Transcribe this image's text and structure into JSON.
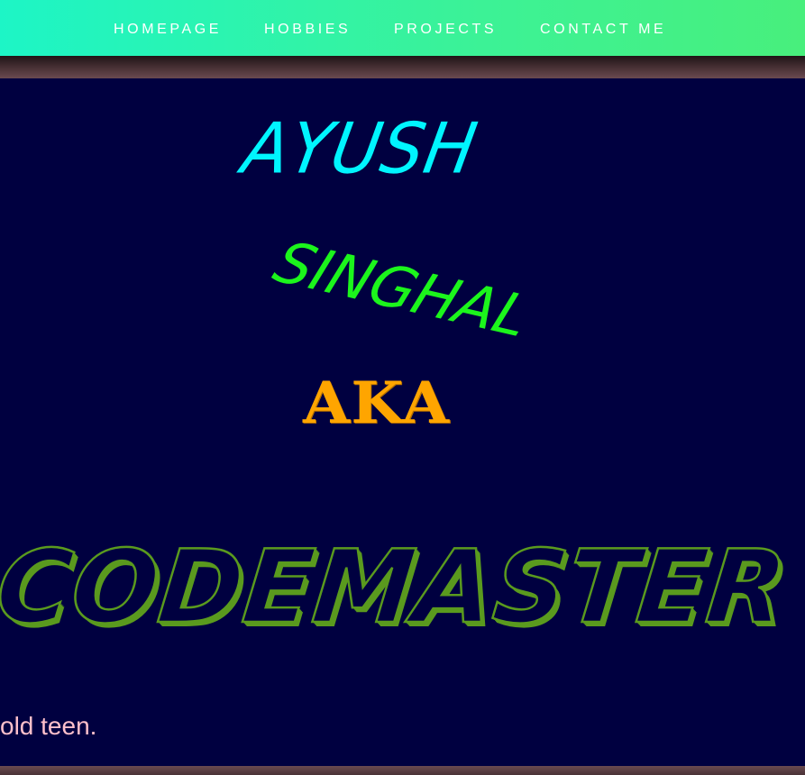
{
  "nav": {
    "items": [
      {
        "label": "HOMEPAGE"
      },
      {
        "label": "HOBBIES"
      },
      {
        "label": "PROJECTS"
      },
      {
        "label": "CONTACT ME"
      }
    ]
  },
  "hero": {
    "first_name": "AYUSH",
    "last_name": "SINGHAL",
    "aka": "AKA",
    "codename": "CODEMASTER",
    "intro_fragment": "old teen."
  },
  "colors": {
    "nav_gradient_start": "#1df5c6",
    "nav_gradient_end": "#48ef7c",
    "nav_text": "#ffffff",
    "background": "#000040",
    "band": "#4a3236",
    "first_name": "#00f5ff",
    "last_name": "#1cf51c",
    "aka": "#ffa500",
    "codename_outline": "#5a9a1e",
    "intro_text": "#ffc0cb"
  }
}
